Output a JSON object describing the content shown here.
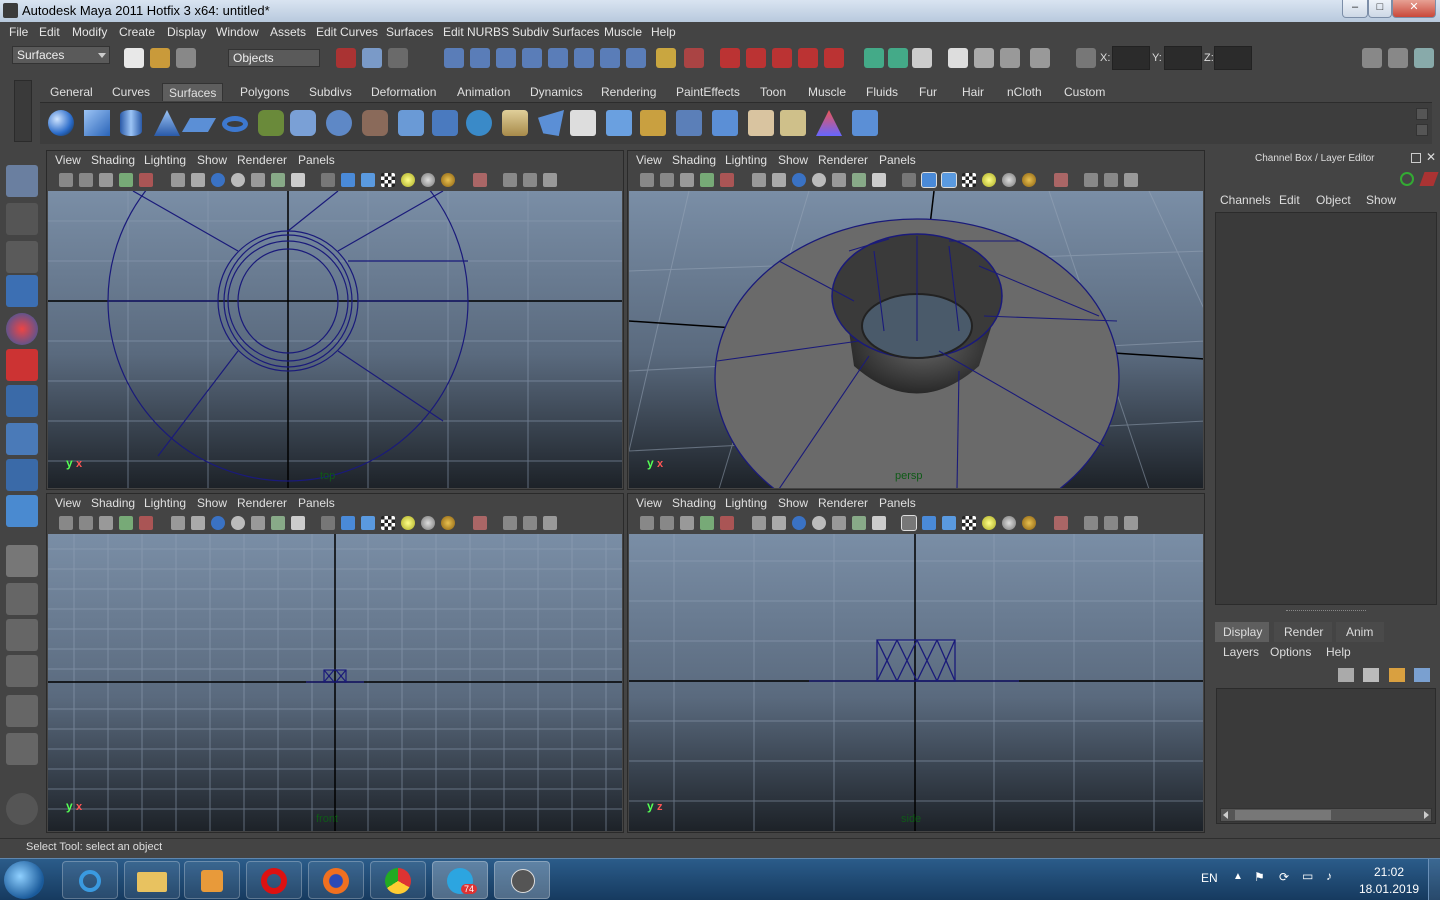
{
  "window": {
    "title": "Autodesk Maya 2011 Hotfix 3 x64: untitled*",
    "controls": [
      "–",
      "□",
      "✕"
    ]
  },
  "menubar": [
    "File",
    "Edit",
    "Modify",
    "Create",
    "Display",
    "Window",
    "Assets",
    "Edit Curves",
    "Surfaces",
    "Edit NURBS",
    "Subdiv Surfaces",
    "Muscle",
    "Help"
  ],
  "statusline": {
    "menuset": "Surfaces",
    "selection_mode": "Objects",
    "x_label": "X:",
    "y_label": "Y:",
    "z_label": "Z:"
  },
  "shelf": {
    "tabs": [
      "General",
      "Curves",
      "Surfaces",
      "Polygons",
      "Subdivs",
      "Deformation",
      "Animation",
      "Dynamics",
      "Rendering",
      "PaintEffects",
      "Toon",
      "Muscle",
      "Fluids",
      "Fur",
      "Hair",
      "nCloth",
      "Custom"
    ],
    "active_tab": "Surfaces"
  },
  "panel_menu": [
    "View",
    "Shading",
    "Lighting",
    "Show",
    "Renderer",
    "Panels"
  ],
  "viewports": [
    {
      "camera": "top",
      "axis1": "y",
      "axis2": "x"
    },
    {
      "camera": "persp",
      "axis1": "y",
      "axis2": "x"
    },
    {
      "camera": "front",
      "axis1": "y",
      "axis2": "x"
    },
    {
      "camera": "side",
      "axis1": "y",
      "axis2": "z"
    }
  ],
  "channel_box": {
    "title": "Channel Box / Layer Editor",
    "menu": [
      "Channels",
      "Edit",
      "Object",
      "Show"
    ],
    "layer_tabs": [
      "Display",
      "Render",
      "Anim"
    ],
    "active_layer_tab": "Display",
    "layer_menu": [
      "Layers",
      "Options",
      "Help"
    ]
  },
  "help_line": "Select Tool: select an object",
  "taskbar": {
    "apps": [
      "Start",
      "Internet Explorer",
      "Windows Explorer",
      "Media Player",
      "Opera",
      "Firefox",
      "Chrome",
      "Telegram",
      "Maya"
    ],
    "telegram_badge": "74",
    "lang": "EN",
    "time": "21:02",
    "date": "18.01.2019"
  },
  "colors": {
    "ui_bg": "#444444",
    "wire": "#1a1a7a",
    "camera_label": "#0f5a17"
  }
}
